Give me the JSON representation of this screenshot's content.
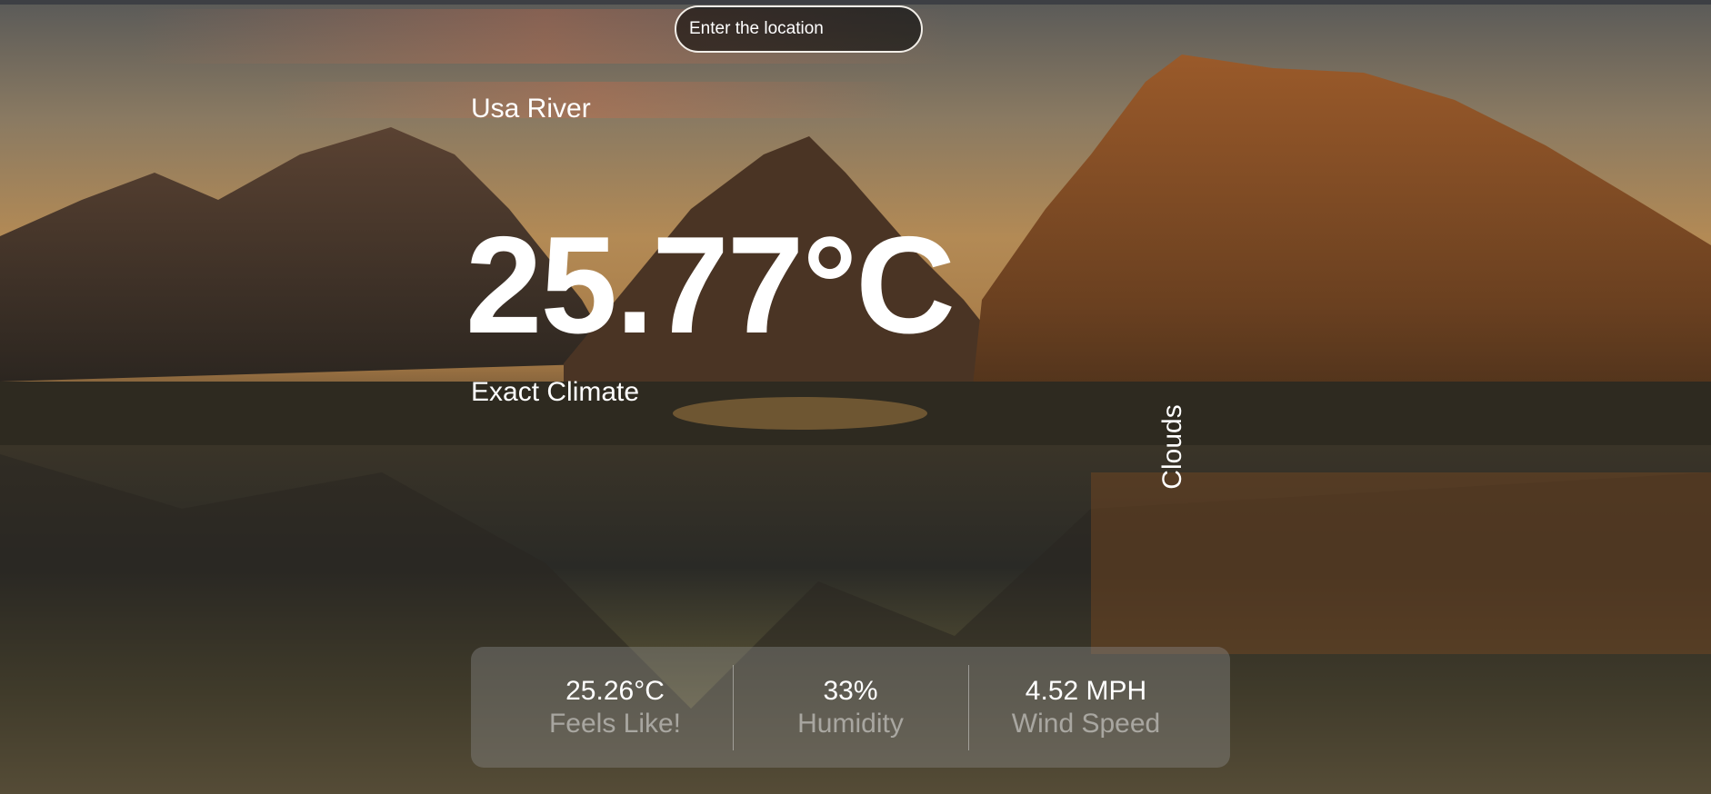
{
  "search": {
    "placeholder": "Enter the location"
  },
  "location": "Usa River",
  "temperature": "25.77°C",
  "description": "Exact Climate",
  "condition": "Clouds",
  "stats": [
    {
      "value": "25.26°C",
      "label": "Feels Like!"
    },
    {
      "value": "33%",
      "label": "Humidity"
    },
    {
      "value": "4.52 MPH",
      "label": "Wind Speed"
    }
  ],
  "background": {
    "scene": "mountain-lake-sunset"
  }
}
